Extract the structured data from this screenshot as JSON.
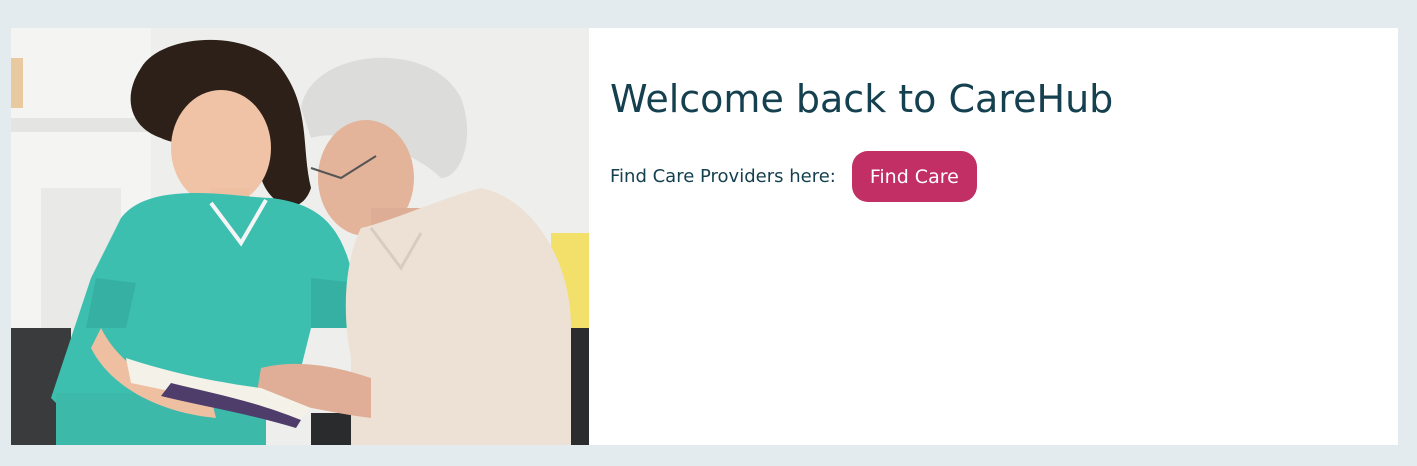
{
  "hero": {
    "title": "Welcome back to CareHub",
    "find_label": "Find Care Providers here:",
    "find_button": "Find Care",
    "photo_alt": "Caregiver reading a book with an elderly woman"
  },
  "colors": {
    "page_bg": "#e3ebee",
    "card_bg": "#ffffff",
    "title_text": "#15404f",
    "button_bg": "#c12f65",
    "button_text": "#ffffff"
  }
}
